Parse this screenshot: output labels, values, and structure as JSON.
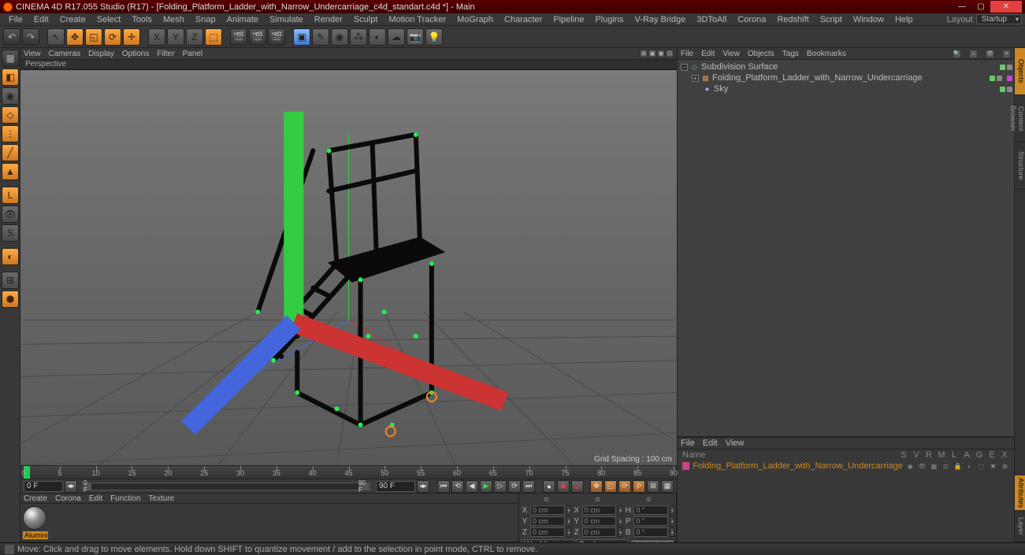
{
  "title": "CINEMA 4D R17.055 Studio (R17) - [Folding_Platform_Ladder_with_Narrow_Undercarriage_c4d_standart.c4d *] - Main",
  "mainmenu": [
    "File",
    "Edit",
    "Create",
    "Select",
    "Tools",
    "Mesh",
    "Snap",
    "Animate",
    "Simulate",
    "Render",
    "Sculpt",
    "Motion Tracker",
    "MoGraph",
    "Character",
    "Pipeline",
    "Plugins",
    "V-Ray Bridge",
    "3DToAll",
    "Corona",
    "Redshift",
    "Script",
    "Window",
    "Help"
  ],
  "layout_label": "Layout",
  "layout_value": "Startup",
  "vpmenu": [
    "View",
    "Cameras",
    "Display",
    "Options",
    "Filter",
    "Panel"
  ],
  "vplabel": "Perspective",
  "grid_spacing": "Grid Spacing : 100 cm",
  "timeline": {
    "start": 0,
    "end": 90,
    "ticks": [
      0,
      5,
      10,
      15,
      20,
      25,
      30,
      35,
      40,
      45,
      50,
      55,
      60,
      65,
      70,
      75,
      80,
      85,
      90
    ]
  },
  "timectl": {
    "start_frame": "0 F",
    "range_start": "0 F",
    "range_end": "90 F",
    "end_frame": "90 F"
  },
  "matmenu": [
    "Create",
    "Corona",
    "Edit",
    "Function",
    "Texture"
  ],
  "material_name": "Aluminii",
  "coord": {
    "cols": [
      "≡",
      "≡",
      "≡"
    ],
    "rows": [
      {
        "a": "X",
        "v1": "0 cm",
        "b": "X",
        "v2": "0 cm",
        "c": "H",
        "v3": "0 °"
      },
      {
        "a": "Y",
        "v1": "0 cm",
        "b": "Y",
        "v2": "0 cm",
        "c": "P",
        "v3": "0 °"
      },
      {
        "a": "Z",
        "v1": "0 cm",
        "b": "Z",
        "v2": "0 cm",
        "c": "B",
        "v3": "0 °"
      }
    ],
    "dd1": "World",
    "dd2": "Scale",
    "apply": "Apply"
  },
  "objmenu": [
    "File",
    "Edit",
    "View",
    "Objects",
    "Tags",
    "Bookmarks"
  ],
  "objects": [
    {
      "indent": 0,
      "exp": "-",
      "icon": "◇",
      "iconColor": "#66cc66",
      "name": "Subdivision Surface",
      "dots": [
        "#66cc66",
        "#888"
      ],
      "tag": ""
    },
    {
      "indent": 1,
      "exp": "+",
      "icon": "▦",
      "iconColor": "#cc9955",
      "name": "Folding_Platform_Ladder_with_Narrow_Undercarriage",
      "dots": [
        "#66cc66",
        "#888"
      ],
      "tag": "#cc44cc"
    },
    {
      "indent": 1,
      "exp": "",
      "icon": "●",
      "iconColor": "#88bbee",
      "name": "Sky",
      "dots": [
        "#66cc66",
        "#888"
      ],
      "tag": ""
    }
  ],
  "rtabs": [
    "Objects",
    "Content Browser",
    "Structure"
  ],
  "attrmenu": [
    "File",
    "Edit",
    "View"
  ],
  "attr": {
    "name_label": "Name",
    "headers": [
      "S",
      "V",
      "R",
      "M",
      "L",
      "A",
      "G",
      "E",
      "X"
    ],
    "row_name": "Folding_Platform_Ladder_with_Narrow_Undercarriage"
  },
  "btabs": [
    "Attributes",
    "Layer"
  ],
  "status": "Move: Click and drag to move elements. Hold down SHIFT to quantize movement / add to the selection in point mode, CTRL to remove."
}
